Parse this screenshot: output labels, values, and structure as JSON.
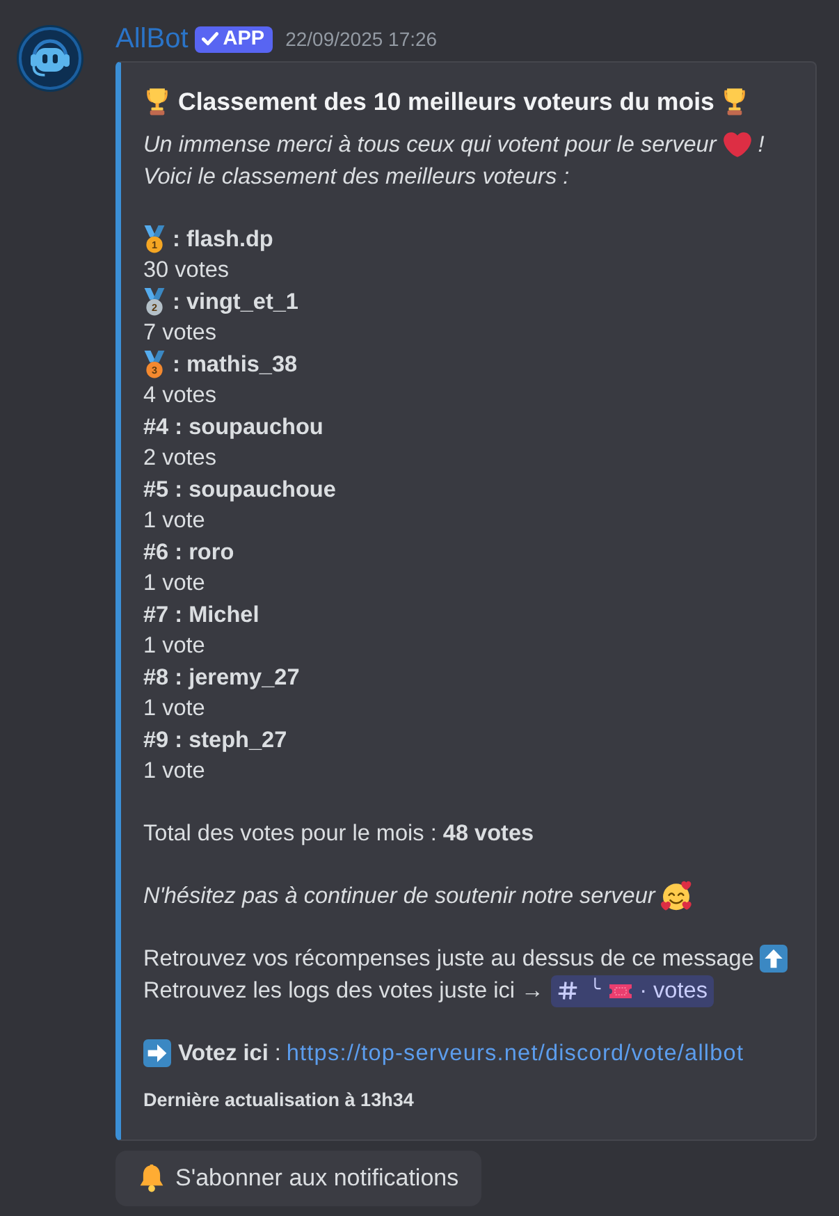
{
  "message": {
    "author": "AllBot",
    "badge": "APP",
    "timestamp": "22/09/2025 17:26"
  },
  "embed": {
    "title": "Classement des 10 meilleurs voteurs du mois",
    "intro": {
      "line_1": "Un immense merci à tous ceux qui votent pour le serveur",
      "line_1_end": "!",
      "line_2": "Voici le classement des meilleurs voteurs :"
    },
    "ranking": [
      {
        "kind": "medal",
        "medal_number": "1",
        "color": "#f5a623",
        "label": ": flash.dp",
        "votes": "30 votes"
      },
      {
        "kind": "medal",
        "medal_number": "2",
        "color": "#b4c0c8",
        "label": ": vingt_et_1",
        "votes": "7 votes"
      },
      {
        "kind": "medal",
        "medal_number": "3",
        "color": "#f4892f",
        "label": ": mathis_38",
        "votes": "4 votes"
      },
      {
        "kind": "plain",
        "label": "#4 : soupauchou",
        "votes": "2 votes"
      },
      {
        "kind": "plain",
        "label": "#5 : soupauchoue",
        "votes": "1 vote"
      },
      {
        "kind": "plain",
        "label": "#6 : roro",
        "votes": "1 vote"
      },
      {
        "kind": "plain",
        "label": "#7 : Michel",
        "votes": "1 vote"
      },
      {
        "kind": "plain",
        "label": "#8 : jeremy_27",
        "votes": "1 vote"
      },
      {
        "kind": "plain",
        "label": "#9 : steph_27",
        "votes": "1 vote"
      }
    ],
    "total": "Total des votes pour le mois : **48 votes**",
    "support": "N'hésitez pas à continuer de soutenir notre serveur",
    "rewards": "Retrouvez vos récompenses juste au dessus de ce message",
    "logs": {
      "text": "Retrouvez les logs des votes juste ici →",
      "channel": {
        "prefix": "╰",
        "name": "· votes"
      }
    },
    "vote": {
      "label": "**Votez ici** :",
      "url": "https://top-serveurs.net/discord/vote/allbot"
    },
    "footer": "Dernière actualisation à 13h34"
  },
  "buttons": [
    {
      "label": "S'abonner aux notifications"
    }
  ]
}
